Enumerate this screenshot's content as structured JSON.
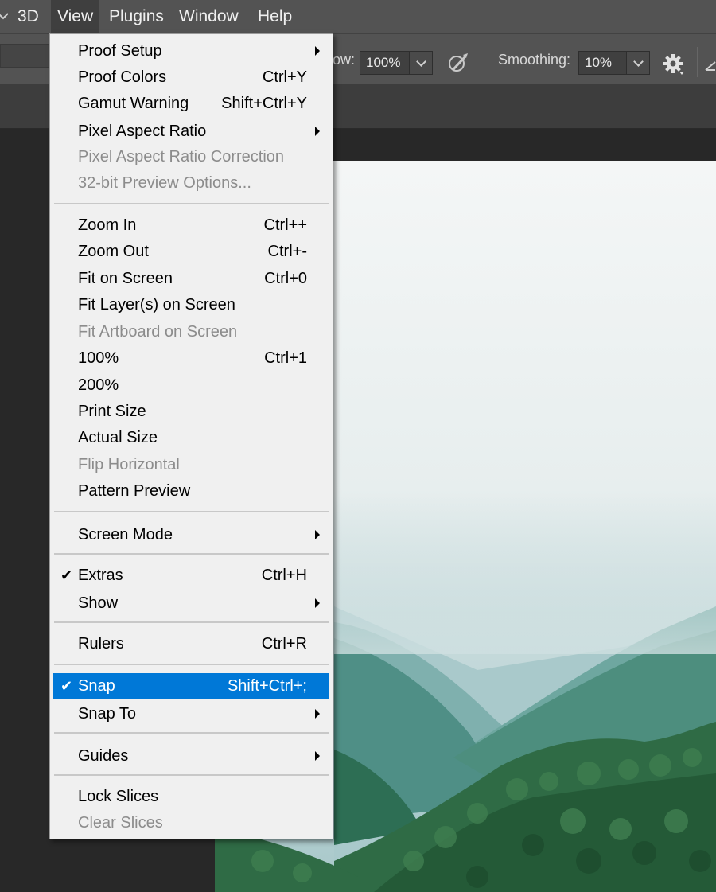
{
  "menubar": {
    "items": [
      "3D",
      "View",
      "Plugins",
      "Window",
      "Help"
    ],
    "active": "View"
  },
  "options_bar": {
    "flow_label": "ow:",
    "flow_value": "100%",
    "smoothing_label": "Smoothing:",
    "smoothing_value": "10%"
  },
  "view_menu": {
    "items": [
      {
        "label": "Proof Setup",
        "shortcut": "",
        "submenu": true
      },
      {
        "label": "Proof Colors",
        "shortcut": "Ctrl+Y"
      },
      {
        "label": "Gamut Warning",
        "shortcut": "Shift+Ctrl+Y"
      },
      {
        "label": "Pixel Aspect Ratio",
        "shortcut": "",
        "submenu": true
      },
      {
        "label": "Pixel Aspect Ratio Correction",
        "shortcut": "",
        "disabled": true
      },
      {
        "label": "32-bit Preview Options...",
        "shortcut": "",
        "disabled": true
      },
      {
        "label": "Zoom In",
        "shortcut": "Ctrl++"
      },
      {
        "label": "Zoom Out",
        "shortcut": "Ctrl+-"
      },
      {
        "label": "Fit on Screen",
        "shortcut": "Ctrl+0"
      },
      {
        "label": "Fit Layer(s) on Screen",
        "shortcut": ""
      },
      {
        "label": "Fit Artboard on Screen",
        "shortcut": "",
        "disabled": true
      },
      {
        "label": "100%",
        "shortcut": "Ctrl+1"
      },
      {
        "label": "200%",
        "shortcut": ""
      },
      {
        "label": "Print Size",
        "shortcut": ""
      },
      {
        "label": "Actual Size",
        "shortcut": ""
      },
      {
        "label": "Flip Horizontal",
        "shortcut": "",
        "disabled": true
      },
      {
        "label": "Pattern Preview",
        "shortcut": ""
      },
      {
        "label": "Screen Mode",
        "shortcut": "",
        "submenu": true
      },
      {
        "label": "Extras",
        "shortcut": "Ctrl+H",
        "checked": true
      },
      {
        "label": "Show",
        "shortcut": "",
        "submenu": true
      },
      {
        "label": "Rulers",
        "shortcut": "Ctrl+R"
      },
      {
        "label": "Snap",
        "shortcut": "Shift+Ctrl+;",
        "checked": true,
        "highlighted": true
      },
      {
        "label": "Snap To",
        "shortcut": "",
        "submenu": true
      },
      {
        "label": "Guides",
        "shortcut": "",
        "submenu": true
      },
      {
        "label": "Lock Slices",
        "shortcut": ""
      },
      {
        "label": "Clear Slices",
        "shortcut": "",
        "disabled": true
      }
    ]
  },
  "colors": {
    "menu_bg": "#f0f0f0",
    "highlight": "#0078d7",
    "disabled_text": "#8c8c8c",
    "app_bg": "#535353",
    "workspace_bg": "#282828"
  },
  "icons": {
    "brush": "brush-pressure-icon",
    "settings": "gear-icon",
    "submenu": "chevron-right-icon",
    "check": "check-icon"
  }
}
